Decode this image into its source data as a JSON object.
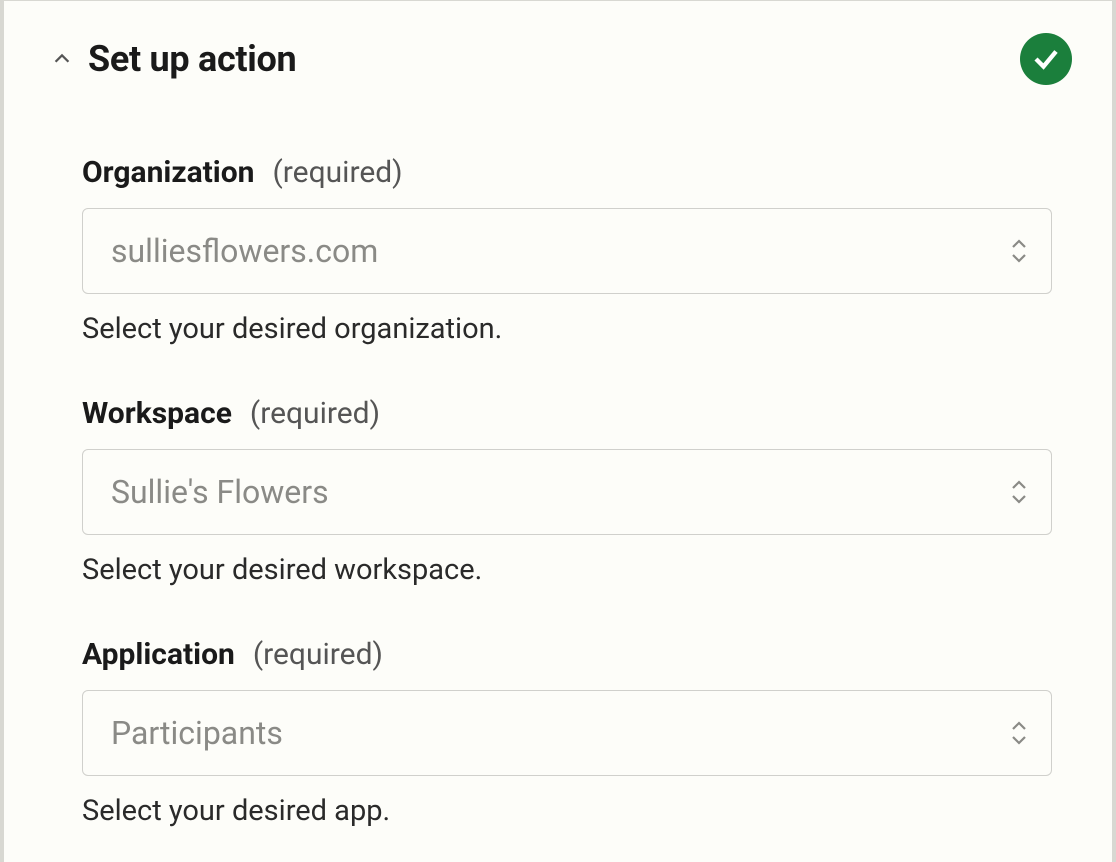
{
  "header": {
    "title": "Set up action",
    "status": "complete"
  },
  "fields": {
    "organization": {
      "label": "Organization",
      "required_text": "(required)",
      "value": "sulliesflowers.com",
      "help": "Select your desired organization."
    },
    "workspace": {
      "label": "Workspace",
      "required_text": "(required)",
      "value": "Sullie's Flowers",
      "help": "Select your desired workspace."
    },
    "application": {
      "label": "Application",
      "required_text": "(required)",
      "value": "Participants",
      "help": "Select your desired app."
    }
  },
  "colors": {
    "success": "#1b7f3c",
    "background": "#fdfdf9",
    "border": "#d0d0cc",
    "text_primary": "#1a1a1a",
    "text_muted": "#8a8a86"
  }
}
